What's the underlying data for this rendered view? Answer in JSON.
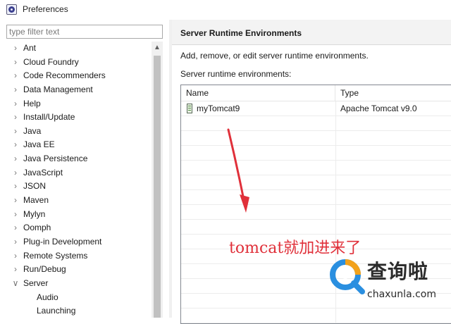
{
  "window": {
    "title": "Preferences"
  },
  "filter": {
    "placeholder": "type filter text",
    "value": ""
  },
  "tree": {
    "items": [
      {
        "label": "Ant",
        "expanded": false,
        "level": 0
      },
      {
        "label": "Cloud Foundry",
        "expanded": false,
        "level": 0
      },
      {
        "label": "Code Recommenders",
        "expanded": false,
        "level": 0
      },
      {
        "label": "Data Management",
        "expanded": false,
        "level": 0
      },
      {
        "label": "Help",
        "expanded": false,
        "level": 0
      },
      {
        "label": "Install/Update",
        "expanded": false,
        "level": 0
      },
      {
        "label": "Java",
        "expanded": false,
        "level": 0
      },
      {
        "label": "Java EE",
        "expanded": false,
        "level": 0
      },
      {
        "label": "Java Persistence",
        "expanded": false,
        "level": 0
      },
      {
        "label": "JavaScript",
        "expanded": false,
        "level": 0
      },
      {
        "label": "JSON",
        "expanded": false,
        "level": 0
      },
      {
        "label": "Maven",
        "expanded": false,
        "level": 0
      },
      {
        "label": "Mylyn",
        "expanded": false,
        "level": 0
      },
      {
        "label": "Oomph",
        "expanded": false,
        "level": 0
      },
      {
        "label": "Plug-in Development",
        "expanded": false,
        "level": 0
      },
      {
        "label": "Remote Systems",
        "expanded": false,
        "level": 0
      },
      {
        "label": "Run/Debug",
        "expanded": false,
        "level": 0
      },
      {
        "label": "Server",
        "expanded": true,
        "level": 0
      },
      {
        "label": "Audio",
        "expanded": false,
        "level": 1
      },
      {
        "label": "Launching",
        "expanded": false,
        "level": 1
      }
    ]
  },
  "page": {
    "title": "Server Runtime Environments",
    "description": "Add, remove, or edit server runtime environments.",
    "list_label": "Server runtime environments:"
  },
  "table": {
    "columns": [
      "Name",
      "Type"
    ],
    "rows": [
      {
        "name": "myTomcat9",
        "type": "Apache Tomcat v9.0",
        "icon": "server-runtime-icon"
      }
    ]
  },
  "annotation": {
    "text": "tomcat就加进来了",
    "color": "#e0303a"
  },
  "watermark": {
    "title": "查询啦",
    "url": "chaxunla.com"
  },
  "icons": {
    "collapsed": "chevron-right-icon",
    "expanded": "chevron-down-icon",
    "scroll_up": "scroll-up-arrow-icon"
  }
}
